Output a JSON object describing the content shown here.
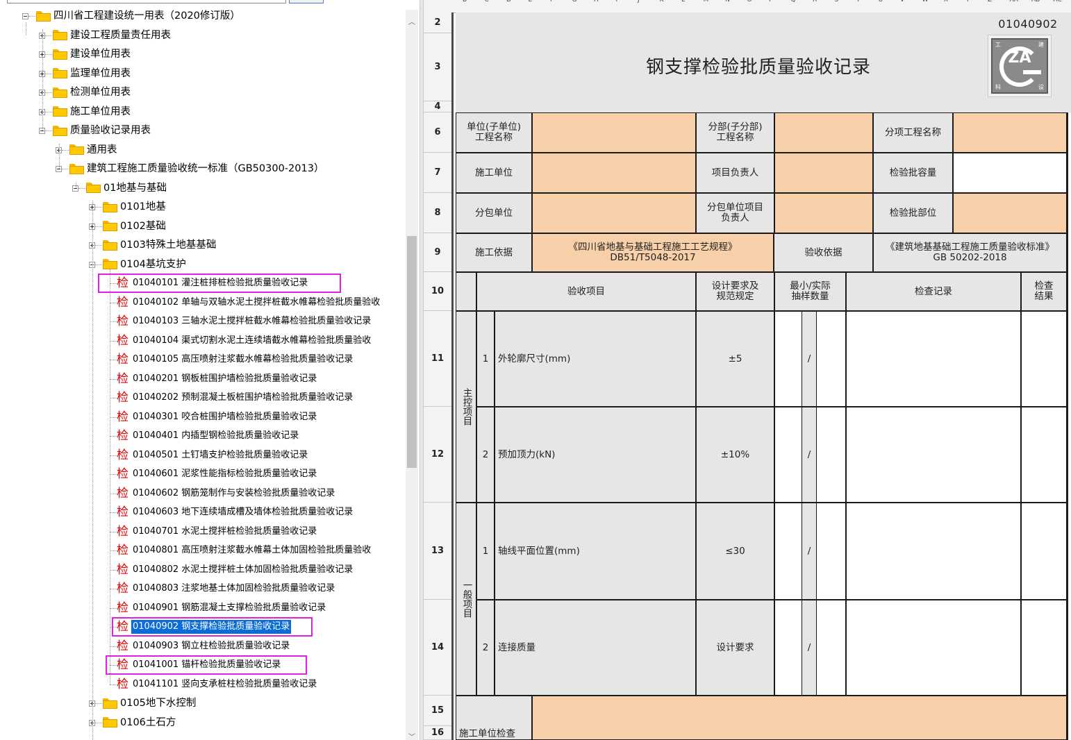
{
  "tree": {
    "root": "四川省工程建设统一用表（2020修订版）",
    "level1": [
      "建设工程质量责任用表",
      "建设单位用表",
      "监理单位用表",
      "检测单位用表",
      "施工单位用表",
      "质量验收记录用表"
    ],
    "level2": [
      "通用表",
      "建筑工程施工质量验收统一标准（GB50300-2013）"
    ],
    "level3": [
      "01地基与基础"
    ],
    "level4": [
      "0101地基",
      "0102基础",
      "0103特殊土地基基础",
      "0104基坑支护"
    ],
    "jian_glyph": "检",
    "records": [
      {
        "code": "01040101",
        "name": "灌注桩排桩检验批质量验收记录"
      },
      {
        "code": "01040102",
        "name": "单轴与双轴水泥土搅拌桩截水帷幕检验批质量验收"
      },
      {
        "code": "01040103",
        "name": "三轴水泥土搅拌桩截水帷幕检验批质量验收记录"
      },
      {
        "code": "01040104",
        "name": "渠式切割水泥土连续墙截水帷幕检验批质量验收"
      },
      {
        "code": "01040105",
        "name": "高压喷射注浆截水帷幕检验批质量验收记录"
      },
      {
        "code": "01040201",
        "name": "钢板桩围护墙检验批质量验收记录"
      },
      {
        "code": "01040202",
        "name": "预制混凝土板桩围护墙检验批质量验收记录"
      },
      {
        "code": "01040301",
        "name": "咬合桩围护墙检验批质量验收记录"
      },
      {
        "code": "01040401",
        "name": "内插型钢检验批质量验收记录"
      },
      {
        "code": "01040501",
        "name": "土钉墙支护检验批质量验收记录"
      },
      {
        "code": "01040601",
        "name": "泥浆性能指标检验批质量验收记录"
      },
      {
        "code": "01040602",
        "name": "钢筋笼制作与安装检验批质量验收记录"
      },
      {
        "code": "01040603",
        "name": "地下连续墙成槽及墙体检验批质量验收记录"
      },
      {
        "code": "01040701",
        "name": "水泥土搅拌桩检验批质量验收记录"
      },
      {
        "code": "01040801",
        "name": "高压喷射注浆截水帷幕土体加固检验批质量验收"
      },
      {
        "code": "01040802",
        "name": "水泥土搅拌桩土体加固检验批质量验收记录"
      },
      {
        "code": "01040803",
        "name": "注浆地基土体加固检验批质量验收记录"
      },
      {
        "code": "01040901",
        "name": "钢筋混凝土支撑检验批质量验收记录"
      },
      {
        "code": "01040902",
        "name": "钢支撑检验批质量验收记录"
      },
      {
        "code": "01040903",
        "name": "钢立柱检验批质量验收记录"
      },
      {
        "code": "01041001",
        "name": "锚杆检验批质量验收记录"
      },
      {
        "code": "01041101",
        "name": "竖向支承桩柱检验批质量验收记录"
      }
    ],
    "after": [
      "0105地下水控制",
      "0106土石方"
    ],
    "selected_code": "01040902",
    "highlight_color": "#e020e0",
    "selection_color": "#0a6cd6"
  },
  "sheet": {
    "col_letters": [
      "B",
      "C",
      "D",
      "E",
      "F",
      "G",
      "H",
      "I",
      "J",
      "K",
      "L",
      "M",
      "N",
      "O",
      "P",
      "Q",
      "R",
      "S",
      "T",
      "U",
      "V",
      "W",
      "X",
      "Y",
      "Z",
      "AA",
      "AB",
      "AC"
    ],
    "row_numbers": [
      "2",
      "3",
      "4",
      "6",
      "7",
      "8",
      "9",
      "10",
      "11",
      "12",
      "13",
      "14",
      "15",
      "16"
    ],
    "form_code": "01040902",
    "title": "钢支撑检验批质量验收记录",
    "logo_text": "ZA",
    "logo_corner_chars": [
      "工",
      "建",
      "科",
      "设"
    ],
    "header": {
      "unit_name": "单位(子单位)工程名称",
      "division_name": "分部(子分部)工程名称",
      "item_name": "分项工程名称",
      "contractor": "施工单位",
      "project_lead": "项目负责人",
      "batch_capacity": "检验批容量",
      "subcontractor": "分包单位",
      "sub_lead": "分包单位项目负责人",
      "batch_location": "检验批部位",
      "construction_basis": "施工依据",
      "construction_basis_value": "《四川省地基与基础工程施工工艺规程》",
      "construction_basis_code": "DB51/T5048-2017",
      "acceptance_basis": "验收依据",
      "acceptance_basis_value": "《建筑地基基础工程施工质量验收标准》",
      "acceptance_basis_code": "GB 50202-2018"
    },
    "table_header": {
      "item": "验收项目",
      "design_req": "设计要求及规范规定",
      "sample": "最小/实际抽样数量",
      "record": "检查记录",
      "result": "检查结果"
    },
    "main_group": "主控项目",
    "general_group": "一般项目",
    "rows": [
      {
        "no": "1",
        "name": "外轮廓尺寸(mm)",
        "req": "±5",
        "sample": "/"
      },
      {
        "no": "2",
        "name": "预加顶力(kN)",
        "req": "±10%",
        "sample": "/"
      },
      {
        "no": "1",
        "name": "轴线平面位置(mm)",
        "req": "≤30",
        "sample": "/"
      },
      {
        "no": "2",
        "name": "连接质量",
        "req": "设计要求",
        "sample": "/"
      }
    ],
    "footer_label": "施工单位检查"
  }
}
